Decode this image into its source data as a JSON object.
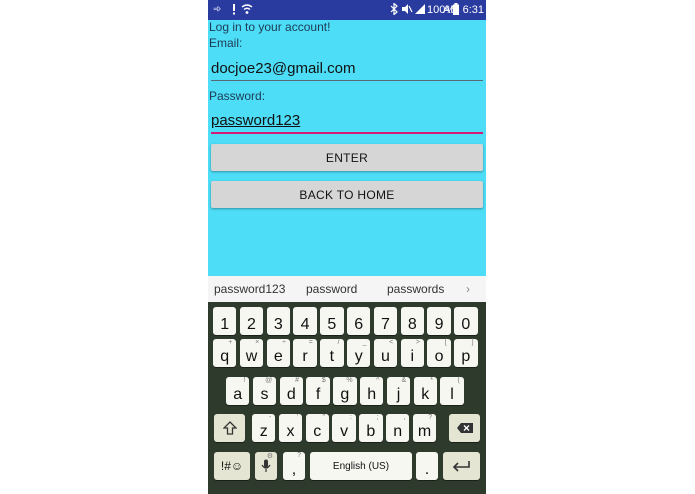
{
  "status_bar": {
    "battery": "100%",
    "time": "6:31 AM"
  },
  "app": {
    "heading": "Log in to your account!",
    "email_label": "Email:",
    "email_value": "docjoe23@gmail.com",
    "password_label": "Password:",
    "password_value": "password123",
    "enter_button": "ENTER",
    "back_button": "BACK TO HOME"
  },
  "suggestions": [
    "password123",
    "password",
    "passwords"
  ],
  "keyboard": {
    "rows": [
      [
        {
          "k": "1"
        },
        {
          "k": "2"
        },
        {
          "k": "3"
        },
        {
          "k": "4"
        },
        {
          "k": "5"
        },
        {
          "k": "6"
        },
        {
          "k": "7"
        },
        {
          "k": "8"
        },
        {
          "k": "9"
        },
        {
          "k": "0"
        }
      ],
      [
        {
          "k": "q",
          "h": "+"
        },
        {
          "k": "w",
          "h": "×"
        },
        {
          "k": "e",
          "h": "÷"
        },
        {
          "k": "r",
          "h": "="
        },
        {
          "k": "t",
          "h": "/"
        },
        {
          "k": "y",
          "h": "_"
        },
        {
          "k": "u",
          "h": "<"
        },
        {
          "k": "i",
          "h": ">"
        },
        {
          "k": "o",
          "h": "["
        },
        {
          "k": "p",
          "h": "]"
        }
      ],
      [
        {
          "k": "a",
          "h": "!"
        },
        {
          "k": "s",
          "h": "@"
        },
        {
          "k": "d",
          "h": "#"
        },
        {
          "k": "f",
          "h": "$"
        },
        {
          "k": "g",
          "h": "%"
        },
        {
          "k": "h",
          "h": "^"
        },
        {
          "k": "j",
          "h": "&"
        },
        {
          "k": "k",
          "h": "*"
        },
        {
          "k": "l",
          "h": "("
        }
      ],
      [
        {
          "k": "z",
          "h": "-"
        },
        {
          "k": "x",
          "h": "'"
        },
        {
          "k": "c",
          "h": "\""
        },
        {
          "k": "v",
          "h": ":"
        },
        {
          "k": "b",
          "h": ";"
        },
        {
          "k": "n",
          "h": ","
        },
        {
          "k": "m",
          "h": "?"
        }
      ]
    ],
    "symbols_key": "!#☺",
    "comma_key": ",",
    "comma_hint": "?",
    "mic_hint": "⚙",
    "space_label": "English (US)",
    "period_key": "."
  },
  "icons": {
    "shift": "shift-arrow-icon",
    "backspace": "backspace-icon",
    "enter": "enter-return-icon",
    "mic": "microphone-icon",
    "suggestion_more": "chevron-right-icon"
  },
  "colors": {
    "app_background": "#4dddf7",
    "status_bar": "#2a3ba0",
    "keyboard_background": "#2e3b2c",
    "focused_underline": "#d51a78"
  }
}
